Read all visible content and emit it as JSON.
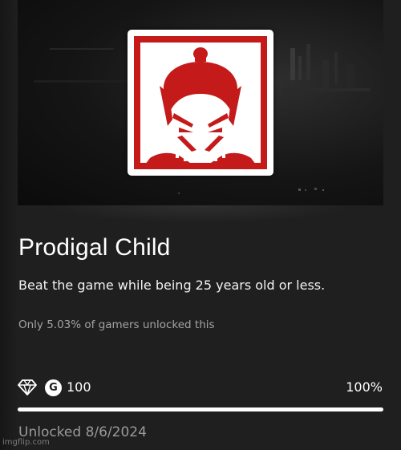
{
  "achievement": {
    "title": "Prodigal Child",
    "description": "Beat the game while being 25 years old or less.",
    "rarity_text": "Only 5.03% of gamers unlocked this",
    "rarity_icon": "diamond-icon",
    "gamerscore_icon_letter": "G",
    "gamerscore": "100",
    "progress_text": "100%",
    "progress_fraction": 1.0,
    "unlocked_text": "Unlocked 8/6/2024",
    "badge_icon": "samurai-face-icon",
    "badge_color": "#c41a1a"
  },
  "watermark": {
    "text": "imgflip.com"
  }
}
